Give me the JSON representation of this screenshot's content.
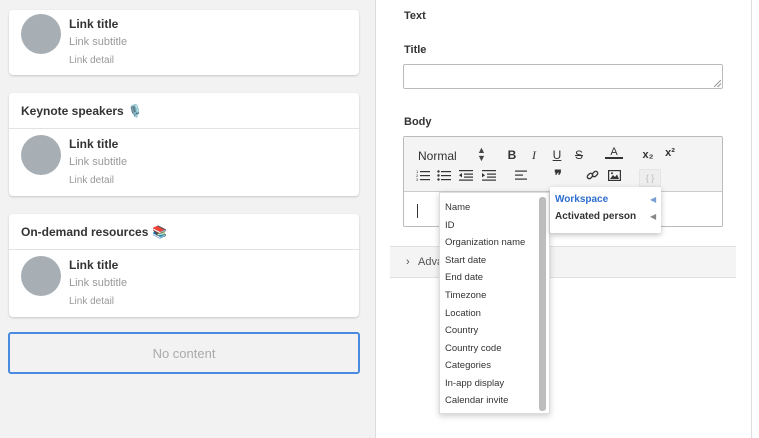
{
  "left": {
    "cards": [
      {
        "header": "",
        "link": {
          "title": "Link title",
          "subtitle": "Link subtitle",
          "detail": "Link detail"
        }
      },
      {
        "header": "Keynote speakers",
        "emoji": "🎙️",
        "link": {
          "title": "Link title",
          "subtitle": "Link subtitle",
          "detail": "Link detail"
        }
      },
      {
        "header": "On-demand resources",
        "emoji": "📚",
        "link": {
          "title": "Link title",
          "subtitle": "Link subtitle",
          "detail": "Link detail"
        }
      }
    ],
    "no_content": "No content"
  },
  "panel": {
    "section_label": "Text",
    "title_label": "Title",
    "title_value": "",
    "body_label": "Body",
    "format_value": "Normal",
    "advanced_label": "Adva"
  },
  "toolbar": {
    "bold": "B",
    "italic": "I",
    "underline": "U",
    "strike": "S",
    "color": "A",
    "sub": "x₂",
    "sup": "x²",
    "quote": "❞",
    "code": "{ }"
  },
  "dropdown": {
    "items": [
      "Name",
      "ID",
      "Organization name",
      "Start date",
      "End date",
      "Timezone",
      "Location",
      "Country",
      "Country code",
      "Categories",
      "In-app display",
      "Calendar invite"
    ]
  },
  "context_menu": {
    "items": [
      {
        "label": "Workspace",
        "color": "#2f6fd1"
      },
      {
        "label": "Activated person",
        "color": "#333333"
      }
    ]
  }
}
